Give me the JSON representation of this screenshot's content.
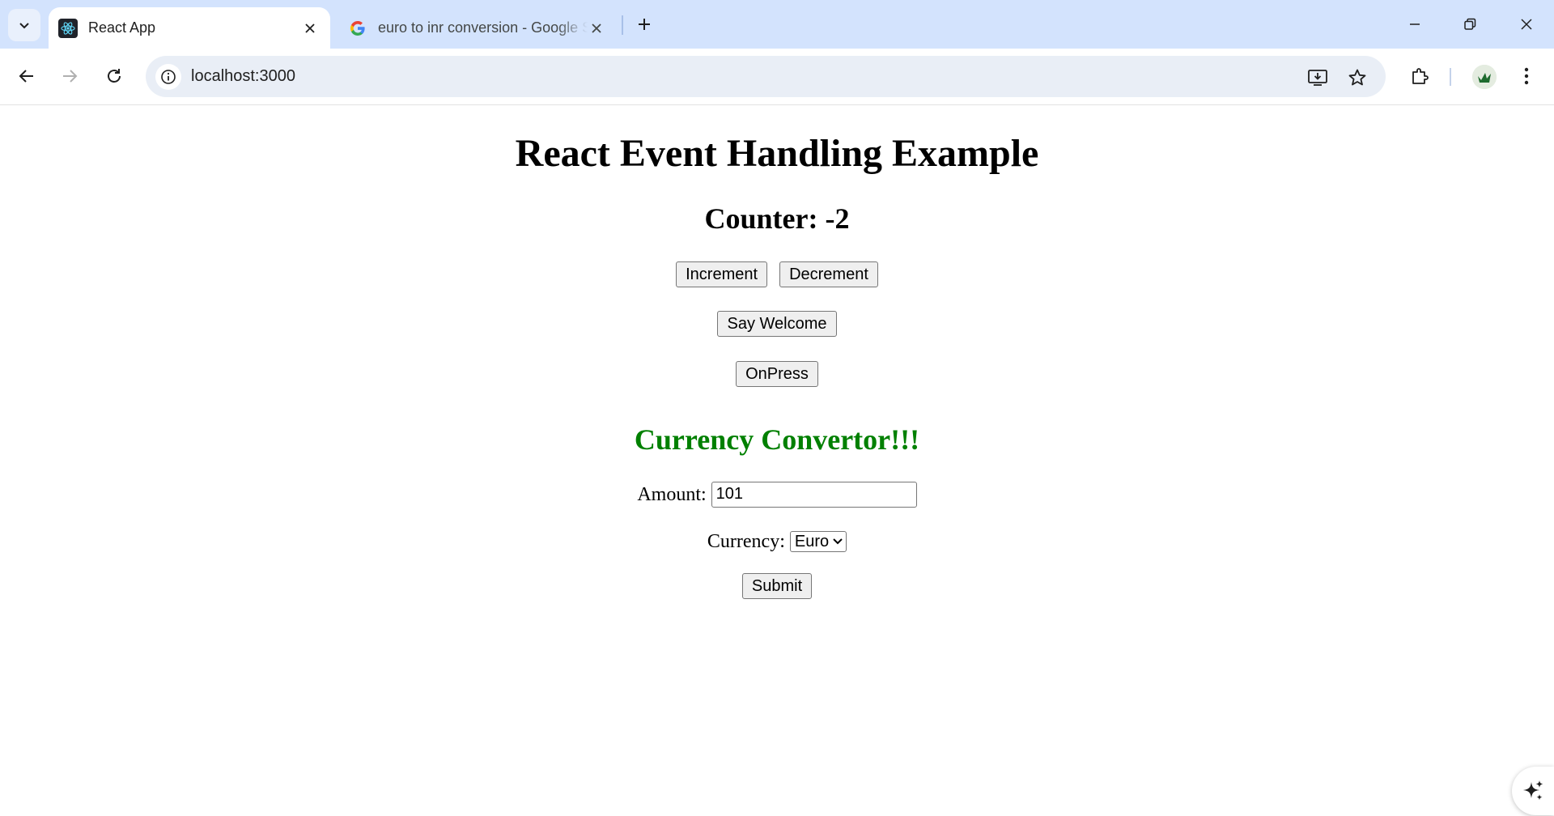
{
  "browser": {
    "tabs": [
      {
        "title": "React App",
        "active": true,
        "favicon": "react-logo-icon"
      },
      {
        "title": "euro to inr conversion - Google Search",
        "active": false,
        "favicon": "google-g-icon"
      }
    ],
    "address": "localhost:3000",
    "colors": {
      "tabstrip": "#d3e3fd",
      "omnibox": "#e9eef6"
    }
  },
  "page": {
    "heading": "React Event Handling Example",
    "counter_text": "Counter: -2",
    "buttons": {
      "increment": "Increment",
      "decrement": "Decrement",
      "say_welcome": "Say Welcome",
      "onpress": "OnPress",
      "submit": "Submit"
    },
    "converter": {
      "title": "Currency Convertor!!!",
      "title_color": "#008000",
      "amount_label": "Amount:",
      "amount_value": "101",
      "currency_label": "Currency:",
      "currency_selected": "Euro"
    }
  }
}
